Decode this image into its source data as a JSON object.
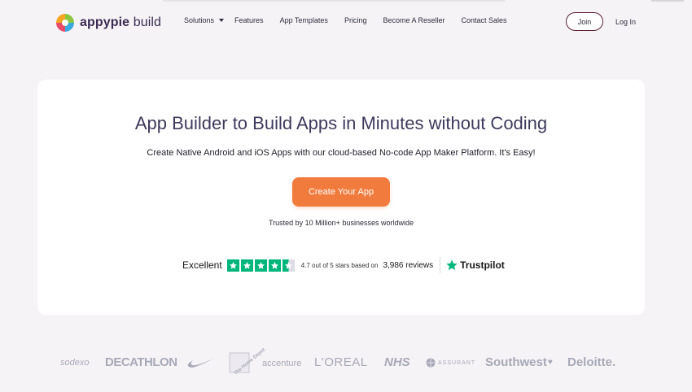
{
  "header": {
    "logo": {
      "brand": "appypie",
      "product": " build"
    },
    "nav": [
      {
        "label": "Solutions",
        "has_dropdown": true
      },
      {
        "label": "Features"
      },
      {
        "label": "App Templates"
      },
      {
        "label": "Pricing"
      },
      {
        "label": "Become A Reseller"
      },
      {
        "label": "Contact Sales"
      }
    ],
    "join_label": "Join",
    "login_label": "Log In"
  },
  "hero": {
    "title": "App Builder to Build Apps in Minutes without Coding",
    "subtitle": "Create Native Android and iOS Apps with our cloud-based No-code App Maker Platform. It's Easy!",
    "cta_label": "Create Your App",
    "trusted_text": "Trusted by 10 Million+ businesses worldwide"
  },
  "rating": {
    "label": "Excellent",
    "stars": 4.5,
    "summary": "4.7 out of 5 stars based on",
    "reviews": "3,986 reviews",
    "provider": "Trustpilot"
  },
  "clients": [
    "sodexo",
    "DECATHLON",
    "nike-swoosh",
    "The Home Depot",
    "accenture",
    "L'OREAL",
    "NHS",
    "ASSURANT",
    "Southwest",
    "Deloitte."
  ],
  "colors": {
    "accent": "#f07b3c",
    "title": "#3d3a5c",
    "trustpilot_green": "#00b67a",
    "join_border": "#5c2333"
  }
}
